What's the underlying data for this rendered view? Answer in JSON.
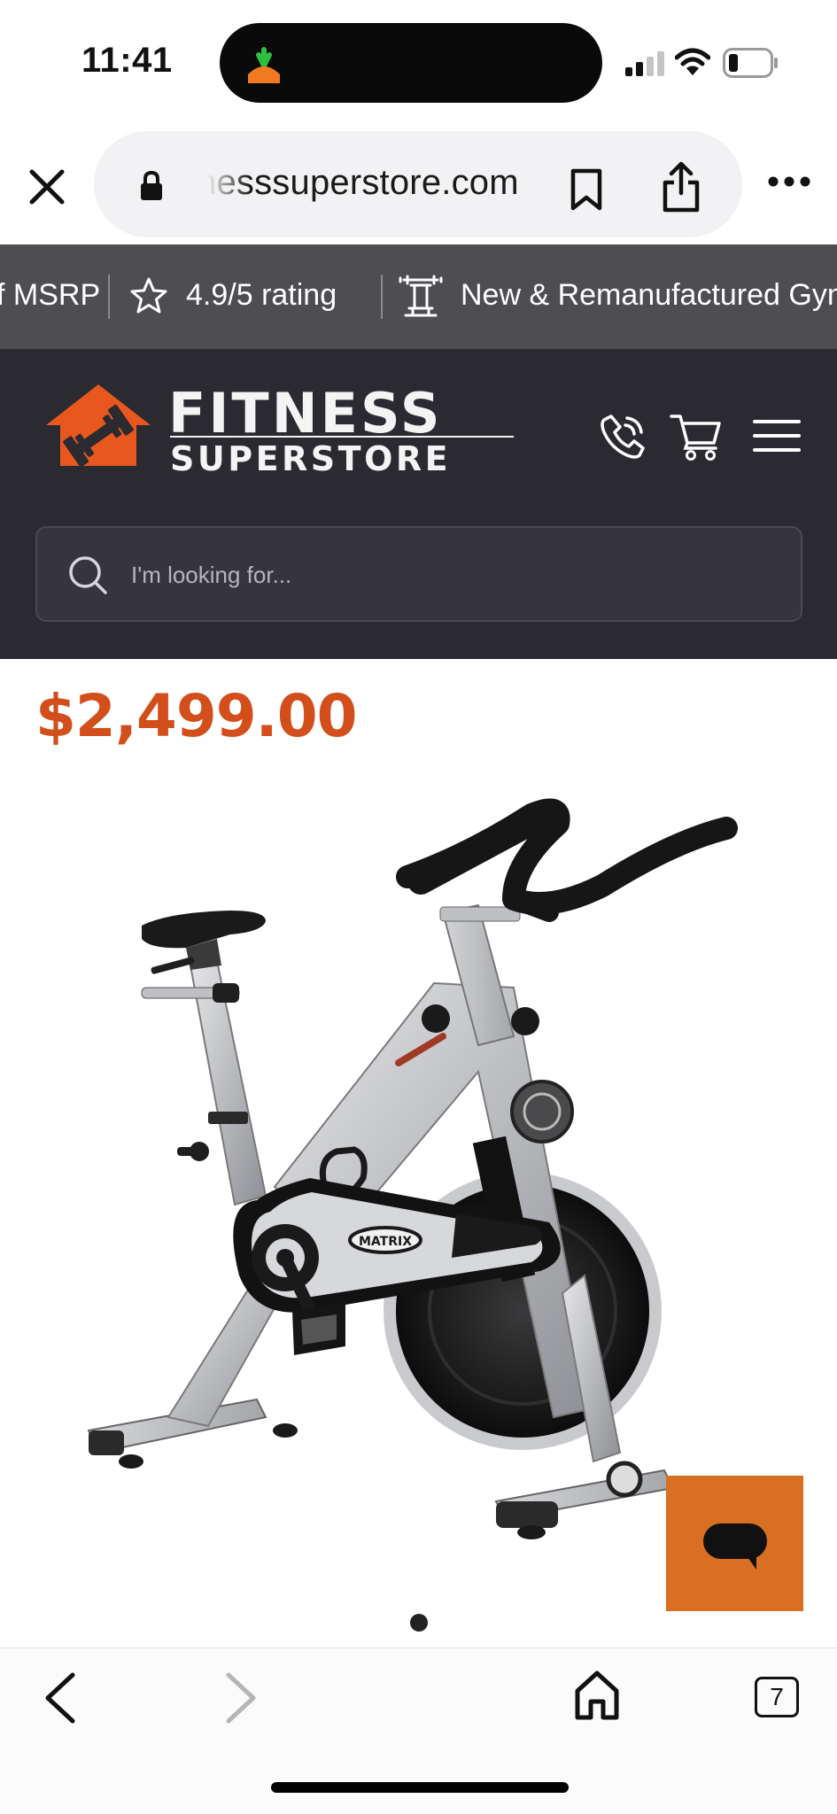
{
  "status_bar": {
    "time": "11:41"
  },
  "browser": {
    "url": "nesssuperstore.com",
    "open_tabs": "7"
  },
  "promo_bar": {
    "items": [
      "f MSRP",
      "4.9/5 rating",
      "New & Remanufactured Gym"
    ]
  },
  "header": {
    "logo_line1": "FITNESS",
    "logo_line2": "SUPERSTORE",
    "search_placeholder": "I'm looking for..."
  },
  "product": {
    "price": "$2,499.00",
    "image_brand_label": "MATRIX",
    "gallery_page": 1,
    "gallery_total": 1
  },
  "colors": {
    "accent_orange": "#d24f1c",
    "chat_orange": "#d96f22",
    "header_bg": "#2b2a31",
    "promo_bg": "#4d4d52"
  }
}
